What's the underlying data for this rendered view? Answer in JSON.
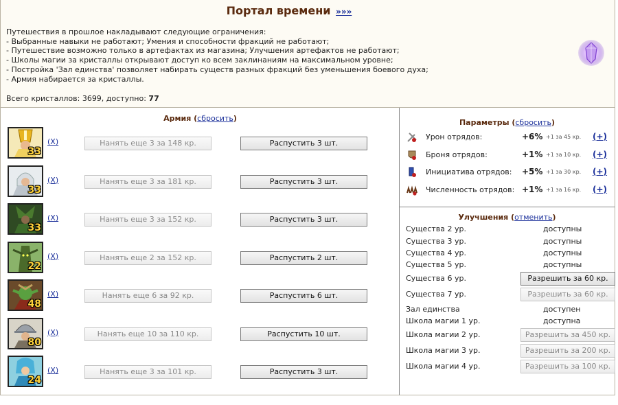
{
  "header": {
    "title": "Портал времени",
    "more_link": "»»»",
    "restrictions": [
      "Путешествия в прошлое накладывают следующие ограничения:",
      "- Выбранные навыки не работают; Умения и способности фракций не работают;",
      "- Путешествие возможно только в артефактах из магазина; Улучшения артефактов не работают;",
      "- Школы магии за кристаллы открывают доступ ко всем заклинаниям на максимальном уровне;",
      "- Постройка 'Зал единства' позволяет набирать существ разных фракций без уменьшения боевого духа;",
      "- Армия набирается за кристаллы."
    ],
    "crystals_text": "Всего кристаллов: 3699, доступно: ",
    "crystals_available": "77"
  },
  "army": {
    "title": "Армия",
    "reset_link": "сбросить",
    "units": [
      {
        "count": "33",
        "x_link": "(X)",
        "hire": "Нанять еще 3 за 148 кр.",
        "dismiss": "Распустить 3 шт.",
        "icon": "priest-icon"
      },
      {
        "count": "33",
        "x_link": "(X)",
        "hire": "Нанять еще 3 за 181 кр.",
        "dismiss": "Распустить 3 шт.",
        "icon": "inquisitor-icon"
      },
      {
        "count": "33",
        "x_link": "(X)",
        "hire": "Нанять еще 3 за 152 кр.",
        "dismiss": "Распустить 3 шт.",
        "icon": "druid-icon"
      },
      {
        "count": "22",
        "x_link": "(X)",
        "hire": "Нанять еще 2 за 152 кр.",
        "dismiss": "Распустить 2 шт.",
        "icon": "treant-icon"
      },
      {
        "count": "48",
        "x_link": "(X)",
        "hire": "Нанять еще 6 за 92 кр.",
        "dismiss": "Распустить 6 шт.",
        "icon": "goblin-icon"
      },
      {
        "count": "80",
        "x_link": "(X)",
        "hire": "Нанять еще 10 за 110 кр.",
        "dismiss": "Распустить 10 шт.",
        "icon": "footman-icon"
      },
      {
        "count": "24",
        "x_link": "(X)",
        "hire": "Нанять еще 3 за 101 кр.",
        "dismiss": "Распустить 3 шт.",
        "icon": "elf-icon"
      }
    ]
  },
  "params": {
    "title": "Параметры",
    "reset_link": "сбросить",
    "rows": [
      {
        "label": "Урон отрядов:",
        "value": "+6%",
        "cost": "+1 за 45 кр.",
        "plus": "(+)",
        "icon": "damage-icon"
      },
      {
        "label": "Броня отрядов:",
        "value": "+1%",
        "cost": "+1 за 10 кр.",
        "plus": "(+)",
        "icon": "armor-icon"
      },
      {
        "label": "Инициатива отрядов:",
        "value": "+5%",
        "cost": "+1 за 30 кр.",
        "plus": "(+)",
        "icon": "initiative-icon"
      },
      {
        "label": "Численность отрядов:",
        "value": "+1%",
        "cost": "+1 за 16 кр.",
        "plus": "(+)",
        "icon": "numbers-icon"
      }
    ]
  },
  "improvements": {
    "title": "Улучшения",
    "cancel_link": "отменить",
    "rows": [
      {
        "label": "Существа 2 ур.",
        "status": "доступны",
        "button": null
      },
      {
        "label": "Существа 3 ур.",
        "status": "доступны",
        "button": null
      },
      {
        "label": "Существа 4 ур.",
        "status": "доступны",
        "button": null
      },
      {
        "label": "Существа 5 ур.",
        "status": "доступны",
        "button": null
      },
      {
        "label": "Существа 6 ур.",
        "status": null,
        "button": "Разрешить за 60 кр.",
        "enabled": true
      },
      {
        "label": "Существа 7 ур.",
        "status": null,
        "button": "Разрешить за 60 кр.",
        "enabled": false
      },
      {
        "label": "Зал единства",
        "status": "доступен",
        "button": null
      },
      {
        "label": "Школа магии 1 ур.",
        "status": "доступна",
        "button": null
      },
      {
        "label": "Школа магии 2 ур.",
        "status": null,
        "button": "Разрешить за 450 кр.",
        "enabled": false
      },
      {
        "label": "Школа магии 3 ур.",
        "status": null,
        "button": "Разрешить за 200 кр.",
        "enabled": false
      },
      {
        "label": "Школа магии 4 ур.",
        "status": null,
        "button": "Разрешить за 100 кр.",
        "enabled": false
      }
    ]
  }
}
